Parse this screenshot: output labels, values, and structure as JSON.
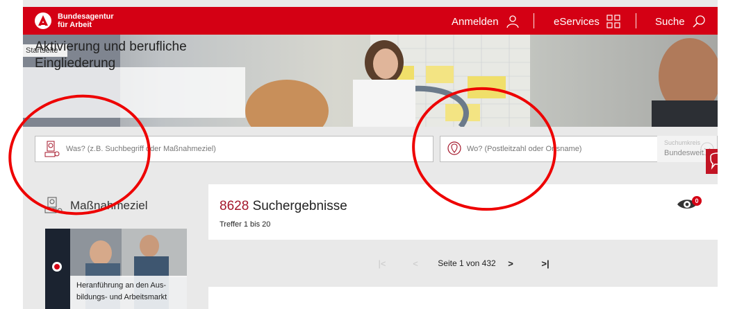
{
  "header": {
    "brand_line1": "Bundesagentur",
    "brand_line2": "für Arbeit",
    "login_label": "Anmelden",
    "eservices_label": "eServices",
    "search_label": "Suche"
  },
  "breadcrumb": {
    "home": "Startseite"
  },
  "hero": {
    "title": "Aktivierung und berufliche Eingliederung"
  },
  "search": {
    "what_placeholder": "Was? (z.B. Suchbegriff oder Maßnahmeziel)",
    "where_placeholder": "Wo? (Postleitzahl oder Ortsname)",
    "radius_label": "Suchumkreis",
    "radius_value": "Bundesweit"
  },
  "filter": {
    "title": "Maßnahmeziel",
    "card_label": "Heranführung an den Ausbildungs- und Arbeitsmarkt",
    "card_line1": "Heranführung an den Aus-",
    "card_line2": "bildungs- und Arbeitsmarkt"
  },
  "results": {
    "count": "8628",
    "count_label": "Suchergebnisse",
    "range": "Treffer 1 bis 20",
    "watch_badge": "0"
  },
  "pagination": {
    "first": "|<",
    "prev": "<",
    "page_text": "Seite 1 von 432",
    "next": ">",
    "last": ">|"
  },
  "colors": {
    "brand": "#d40014",
    "accent": "#a4162a",
    "annotation": "#ee0000"
  }
}
